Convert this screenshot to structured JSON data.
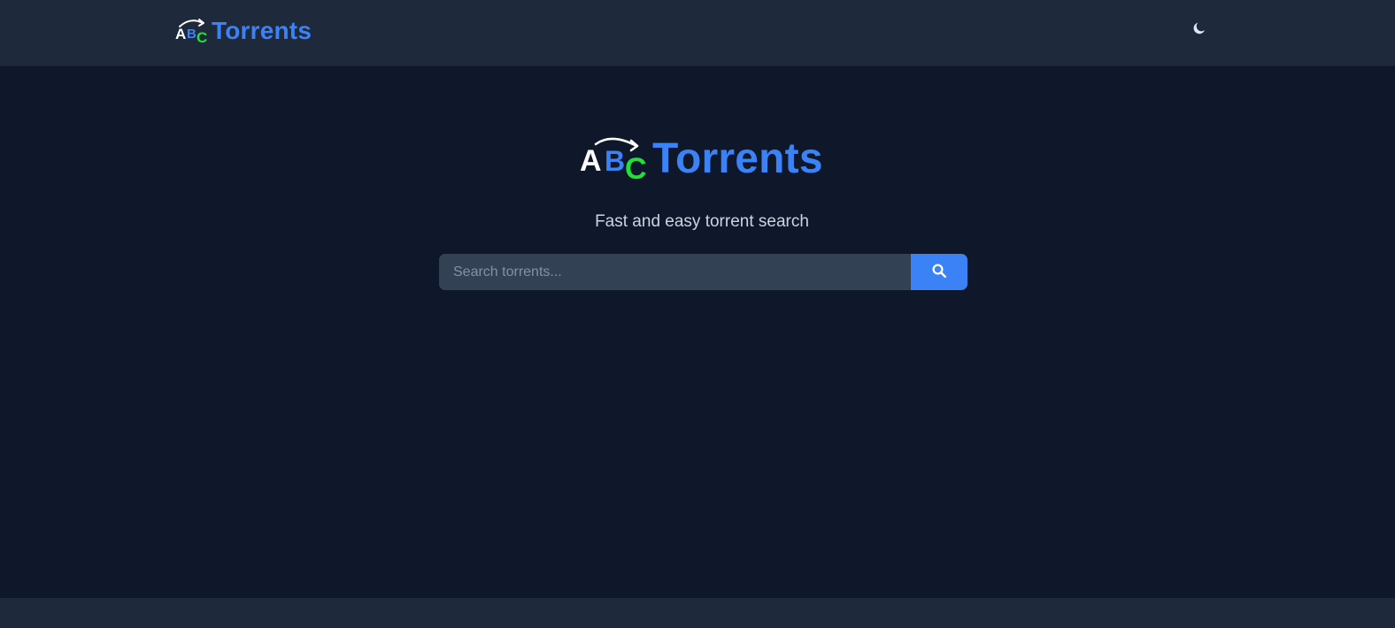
{
  "header": {
    "logo_text": "Torrents",
    "theme_toggle_icon": "moon-icon"
  },
  "hero": {
    "logo_text": "Torrents",
    "tagline": "Fast and easy torrent search"
  },
  "search": {
    "placeholder": "Search torrents...",
    "value": "",
    "button_icon": "search-icon"
  },
  "colors": {
    "background": "#0f172a",
    "header_bg": "#1e293b",
    "accent": "#3b82f6",
    "logo_a": "#ffffff",
    "logo_b": "#3b82f6",
    "logo_c": "#22e03a",
    "input_bg": "#334155",
    "tagline": "#cbd5e1"
  }
}
